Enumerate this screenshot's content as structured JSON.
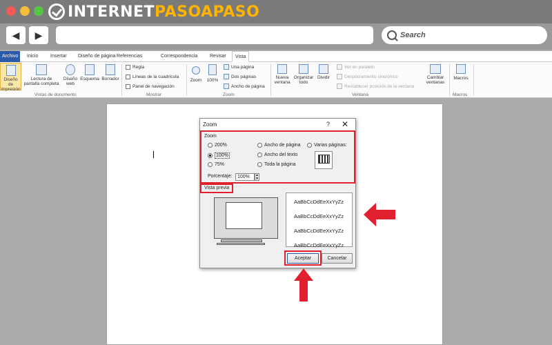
{
  "browser": {
    "brand_prefix": "INTERNET",
    "brand_accent": "PASOAPASO",
    "search_placeholder": "Search"
  },
  "ribbon": {
    "tabs": [
      "Archivo",
      "Inicio",
      "Insertar",
      "Diseño de página",
      "Referencias",
      "Correspondencia",
      "Revisar",
      "Vista"
    ],
    "active_tab": "Vista",
    "vistas": {
      "impresion_line1": "Diseño de",
      "impresion_line2": "impresión",
      "lectura_line1": "Lectura de",
      "lectura_line2": "pantalla completa",
      "web_line1": "Diseño",
      "web_line2": "web",
      "esquema": "Esquema",
      "borrador": "Borrador",
      "group": "Vistas de documento"
    },
    "mostrar": {
      "regla": "Regla",
      "cuadricula": "Líneas de la cuadrícula",
      "panel": "Panel de navegación",
      "group": "Mostrar"
    },
    "zoom": {
      "zoom": "Zoom",
      "cien": "100%",
      "una": "Una página",
      "dos": "Dos páginas",
      "ancho": "Ancho de página",
      "group": "Zoom"
    },
    "ventana": {
      "nueva_line1": "Nueva",
      "nueva_line2": "ventana",
      "organizar_line1": "Organizar",
      "organizar_line2": "todo",
      "dividir": "Dividir",
      "paralelo": "Ver en paralelo",
      "sincronico": "Desplazamiento sincrónico",
      "restablecer": "Restablecer posición de la ventana",
      "cambiar_line1": "Cambiar",
      "cambiar_line2": "ventanas",
      "group": "Ventana"
    },
    "macros": {
      "label": "Macros",
      "group": "Macros"
    }
  },
  "dialog": {
    "title": "Zoom",
    "help": "?",
    "close": "✕",
    "zoom_section": "Zoom",
    "options": {
      "p200": "200%",
      "p100": "100%",
      "p75": "75%",
      "ancho_pagina": "Ancho de página",
      "ancho_texto": "Ancho del texto",
      "toda_pagina": "Toda la página",
      "varias": "Varias páginas:"
    },
    "selected_option": "100%",
    "porcentaje_label": "Porcentaje:",
    "porcentaje_value": "100%",
    "preview_section": "Vista previa",
    "sample_text": "AaBbCcDdEeXxYyZz",
    "accept": "Aceptar",
    "cancel": "Cancelar"
  },
  "colors": {
    "highlight": "#e0202e",
    "file_tab": "#2a5aa8"
  }
}
